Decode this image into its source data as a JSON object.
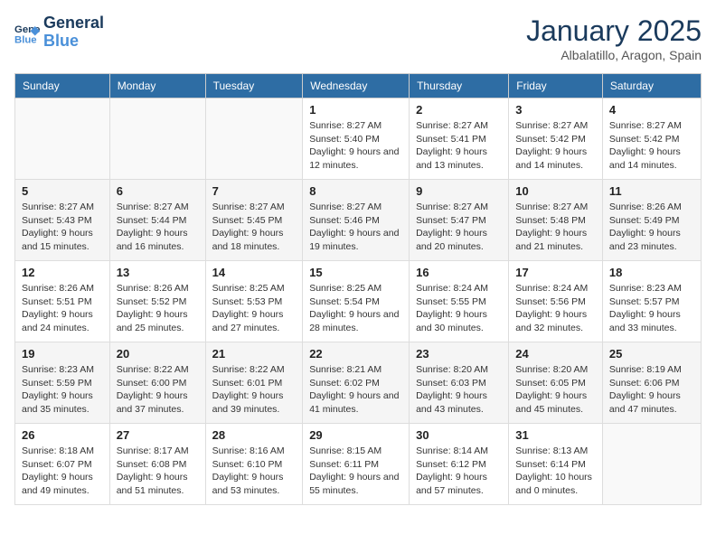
{
  "header": {
    "logo_general": "General",
    "logo_blue": "Blue",
    "month_title": "January 2025",
    "location": "Albalatillo, Aragon, Spain"
  },
  "weekdays": [
    "Sunday",
    "Monday",
    "Tuesday",
    "Wednesday",
    "Thursday",
    "Friday",
    "Saturday"
  ],
  "weeks": [
    [
      {
        "day": "",
        "info": ""
      },
      {
        "day": "",
        "info": ""
      },
      {
        "day": "",
        "info": ""
      },
      {
        "day": "1",
        "info": "Sunrise: 8:27 AM\nSunset: 5:40 PM\nDaylight: 9 hours and 12 minutes."
      },
      {
        "day": "2",
        "info": "Sunrise: 8:27 AM\nSunset: 5:41 PM\nDaylight: 9 hours and 13 minutes."
      },
      {
        "day": "3",
        "info": "Sunrise: 8:27 AM\nSunset: 5:42 PM\nDaylight: 9 hours and 14 minutes."
      },
      {
        "day": "4",
        "info": "Sunrise: 8:27 AM\nSunset: 5:42 PM\nDaylight: 9 hours and 14 minutes."
      }
    ],
    [
      {
        "day": "5",
        "info": "Sunrise: 8:27 AM\nSunset: 5:43 PM\nDaylight: 9 hours and 15 minutes."
      },
      {
        "day": "6",
        "info": "Sunrise: 8:27 AM\nSunset: 5:44 PM\nDaylight: 9 hours and 16 minutes."
      },
      {
        "day": "7",
        "info": "Sunrise: 8:27 AM\nSunset: 5:45 PM\nDaylight: 9 hours and 18 minutes."
      },
      {
        "day": "8",
        "info": "Sunrise: 8:27 AM\nSunset: 5:46 PM\nDaylight: 9 hours and 19 minutes."
      },
      {
        "day": "9",
        "info": "Sunrise: 8:27 AM\nSunset: 5:47 PM\nDaylight: 9 hours and 20 minutes."
      },
      {
        "day": "10",
        "info": "Sunrise: 8:27 AM\nSunset: 5:48 PM\nDaylight: 9 hours and 21 minutes."
      },
      {
        "day": "11",
        "info": "Sunrise: 8:26 AM\nSunset: 5:49 PM\nDaylight: 9 hours and 23 minutes."
      }
    ],
    [
      {
        "day": "12",
        "info": "Sunrise: 8:26 AM\nSunset: 5:51 PM\nDaylight: 9 hours and 24 minutes."
      },
      {
        "day": "13",
        "info": "Sunrise: 8:26 AM\nSunset: 5:52 PM\nDaylight: 9 hours and 25 minutes."
      },
      {
        "day": "14",
        "info": "Sunrise: 8:25 AM\nSunset: 5:53 PM\nDaylight: 9 hours and 27 minutes."
      },
      {
        "day": "15",
        "info": "Sunrise: 8:25 AM\nSunset: 5:54 PM\nDaylight: 9 hours and 28 minutes."
      },
      {
        "day": "16",
        "info": "Sunrise: 8:24 AM\nSunset: 5:55 PM\nDaylight: 9 hours and 30 minutes."
      },
      {
        "day": "17",
        "info": "Sunrise: 8:24 AM\nSunset: 5:56 PM\nDaylight: 9 hours and 32 minutes."
      },
      {
        "day": "18",
        "info": "Sunrise: 8:23 AM\nSunset: 5:57 PM\nDaylight: 9 hours and 33 minutes."
      }
    ],
    [
      {
        "day": "19",
        "info": "Sunrise: 8:23 AM\nSunset: 5:59 PM\nDaylight: 9 hours and 35 minutes."
      },
      {
        "day": "20",
        "info": "Sunrise: 8:22 AM\nSunset: 6:00 PM\nDaylight: 9 hours and 37 minutes."
      },
      {
        "day": "21",
        "info": "Sunrise: 8:22 AM\nSunset: 6:01 PM\nDaylight: 9 hours and 39 minutes."
      },
      {
        "day": "22",
        "info": "Sunrise: 8:21 AM\nSunset: 6:02 PM\nDaylight: 9 hours and 41 minutes."
      },
      {
        "day": "23",
        "info": "Sunrise: 8:20 AM\nSunset: 6:03 PM\nDaylight: 9 hours and 43 minutes."
      },
      {
        "day": "24",
        "info": "Sunrise: 8:20 AM\nSunset: 6:05 PM\nDaylight: 9 hours and 45 minutes."
      },
      {
        "day": "25",
        "info": "Sunrise: 8:19 AM\nSunset: 6:06 PM\nDaylight: 9 hours and 47 minutes."
      }
    ],
    [
      {
        "day": "26",
        "info": "Sunrise: 8:18 AM\nSunset: 6:07 PM\nDaylight: 9 hours and 49 minutes."
      },
      {
        "day": "27",
        "info": "Sunrise: 8:17 AM\nSunset: 6:08 PM\nDaylight: 9 hours and 51 minutes."
      },
      {
        "day": "28",
        "info": "Sunrise: 8:16 AM\nSunset: 6:10 PM\nDaylight: 9 hours and 53 minutes."
      },
      {
        "day": "29",
        "info": "Sunrise: 8:15 AM\nSunset: 6:11 PM\nDaylight: 9 hours and 55 minutes."
      },
      {
        "day": "30",
        "info": "Sunrise: 8:14 AM\nSunset: 6:12 PM\nDaylight: 9 hours and 57 minutes."
      },
      {
        "day": "31",
        "info": "Sunrise: 8:13 AM\nSunset: 6:14 PM\nDaylight: 10 hours and 0 minutes."
      },
      {
        "day": "",
        "info": ""
      }
    ]
  ]
}
